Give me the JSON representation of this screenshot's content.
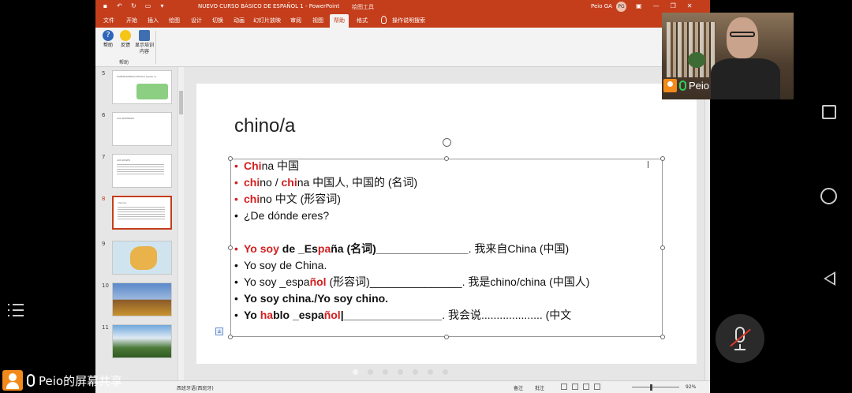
{
  "window": {
    "doc_title": "NUEVO CURSO BÁSICO DE ESPAÑOL 1  -  PowerPoint",
    "context_tools": "绘图工具",
    "user_name": "Peio GA",
    "user_initials": "PG"
  },
  "tabs": [
    {
      "label": "文件"
    },
    {
      "label": "开始"
    },
    {
      "label": "插入"
    },
    {
      "label": "绘图"
    },
    {
      "label": "设计"
    },
    {
      "label": "切换"
    },
    {
      "label": "动画"
    },
    {
      "label": "幻灯片放映"
    },
    {
      "label": "审阅"
    },
    {
      "label": "视图"
    },
    {
      "label": "帮助"
    },
    {
      "label": "格式"
    }
  ],
  "tell_me": "操作说明搜索",
  "ribbon": {
    "help_label": "帮助",
    "feedback_label": "反馈",
    "training_label": "显示培训内容",
    "group_label": "帮助"
  },
  "thumbnails": [
    {
      "num": "5",
      "text": "SUPERVIVENCIA BÁSICA (parte 1)"
    },
    {
      "num": "6",
      "text": "LOS NÚMEROS"
    },
    {
      "num": "7",
      "text": "LOS PAÍSES"
    },
    {
      "num": "8",
      "text": "chino/a"
    },
    {
      "num": "9",
      "text": ""
    },
    {
      "num": "10",
      "text": ""
    },
    {
      "num": "11",
      "text": ""
    }
  ],
  "slide": {
    "title": "chino/a"
  },
  "status": {
    "language": "西班牙语(西班牙)",
    "notes": "备注",
    "comments": "批注",
    "zoom": "92%"
  },
  "participant": {
    "name": "Peio"
  },
  "share_label": "Peio的屏幕共享",
  "colors": {
    "ppt_accent": "#c43e1c",
    "slide_red": "#d32020",
    "avatar_orange": "#f28a1b",
    "mic_green": "#2fd05b"
  }
}
